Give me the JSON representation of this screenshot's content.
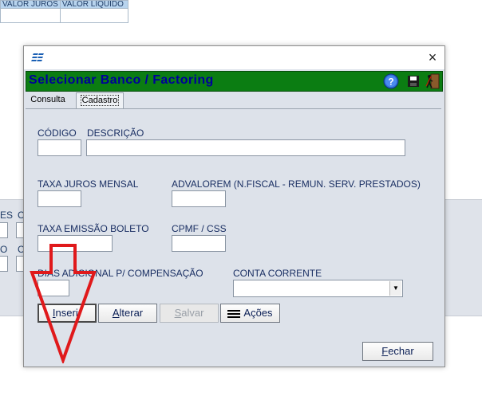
{
  "background": {
    "table_headers": [
      "VALOR JUROS",
      "VALOR LÍQUIDO"
    ],
    "panel_labels": [
      "ES",
      "C",
      "O",
      "C"
    ]
  },
  "dialog": {
    "title": "Selecionar Banco / Factoring",
    "close_glyph": "×",
    "tabs": [
      {
        "label": "Consulta",
        "active": false
      },
      {
        "label": "Cadastro",
        "active": true
      }
    ],
    "fields": {
      "codigo": {
        "label": "CÓDIGO",
        "value": ""
      },
      "descricao": {
        "label": "DESCRIÇÃO",
        "value": ""
      },
      "taxa_juros_mensal": {
        "label": "TAXA JUROS MENSAL",
        "value": ""
      },
      "advalorem": {
        "label": "ADVALOREM (N.FISCAL - REMUN. SERV. PRESTADOS)",
        "value": ""
      },
      "taxa_emissao_boleto": {
        "label": "TAXA EMISSÃO BOLETO",
        "value": ""
      },
      "cpmf_css": {
        "label": "CPMF / CSS",
        "value": ""
      },
      "dias_adicional": {
        "label": "DIAS ADICIONAL P/ COMPENSAÇÃO",
        "value": ""
      },
      "conta_corrente": {
        "label": "CONTA CORRENTE",
        "value": ""
      }
    },
    "buttons": {
      "inserir": {
        "label_u": "I",
        "label_rest": "nserir"
      },
      "alterar": {
        "label_u": "A",
        "label_rest": "lterar"
      },
      "salvar": {
        "label_u": "S",
        "label_rest": "alvar"
      },
      "acoes": {
        "label": "Ações"
      },
      "fechar": {
        "label_u": "F",
        "label_rest": "echar"
      }
    },
    "icons": [
      "app-logo-icon",
      "close-icon",
      "help-icon",
      "save-icon",
      "exit-icon",
      "menu-icon"
    ]
  },
  "colors": {
    "banner": "#0b7d12",
    "banner_text": "#00009a",
    "annotation_arrow": "#e0191b"
  }
}
